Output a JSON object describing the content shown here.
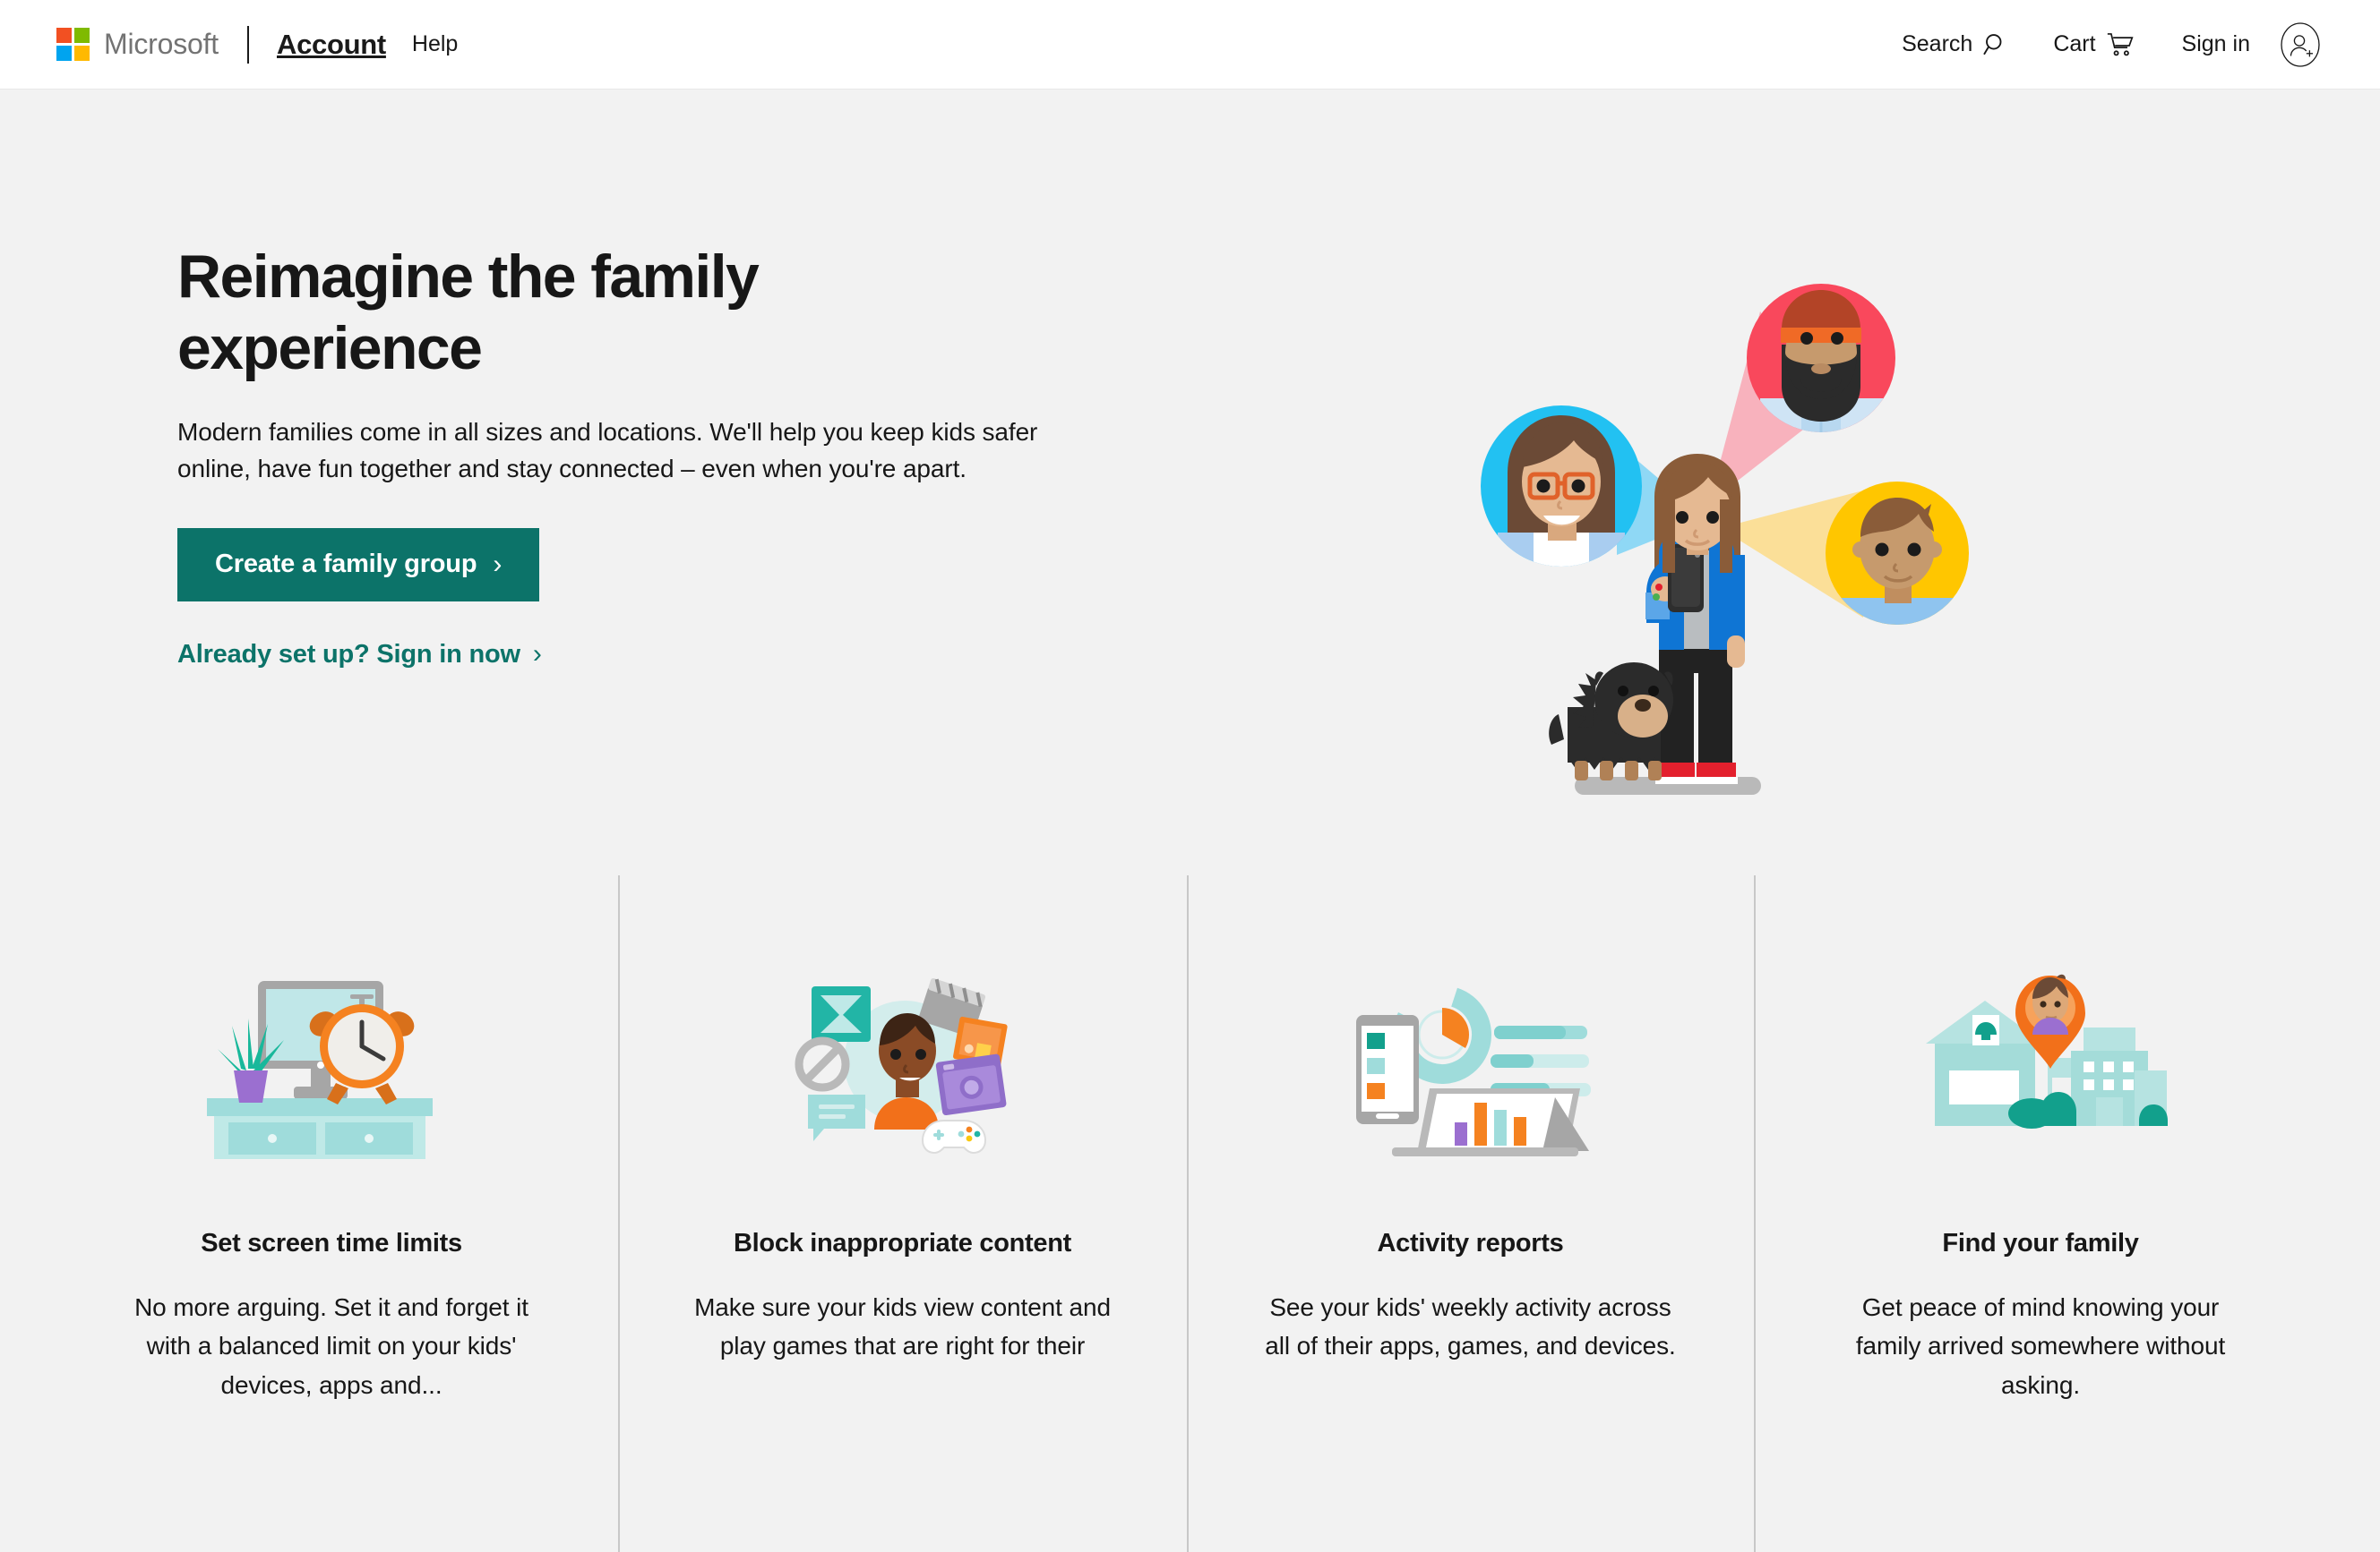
{
  "header": {
    "brand": "Microsoft",
    "product": "Account",
    "help_label": "Help",
    "search_label": "Search",
    "cart_label": "Cart",
    "signin_label": "Sign in",
    "logo_colors": {
      "red": "#f25022",
      "green": "#7fba00",
      "blue": "#00a4ef",
      "yellow": "#ffb900"
    }
  },
  "hero": {
    "title": "Reimagine the family experience",
    "subtitle": "Modern families come in all sizes and locations. We'll help you keep kids safer online, have fun together and stay connected – even when you're apart.",
    "primary_cta": "Create a family group",
    "primary_cta_chevron": "›",
    "secondary_cta": "Already set up? Sign in now",
    "secondary_cta_chevron": "›",
    "accent_color": "#0c7369"
  },
  "features": [
    {
      "title": "Set screen time limits",
      "body": "No more arguing. Set it and forget it with a balanced limit on your kids' devices, apps and..."
    },
    {
      "title": "Block inappropriate content",
      "body": "Make sure your kids view content and play games that are right for their"
    },
    {
      "title": "Activity reports",
      "body": "See your kids' weekly activity across all of their apps, games, and devices."
    },
    {
      "title": "Find your family",
      "body": "Get peace of mind knowing your family arrived somewhere without asking."
    }
  ]
}
